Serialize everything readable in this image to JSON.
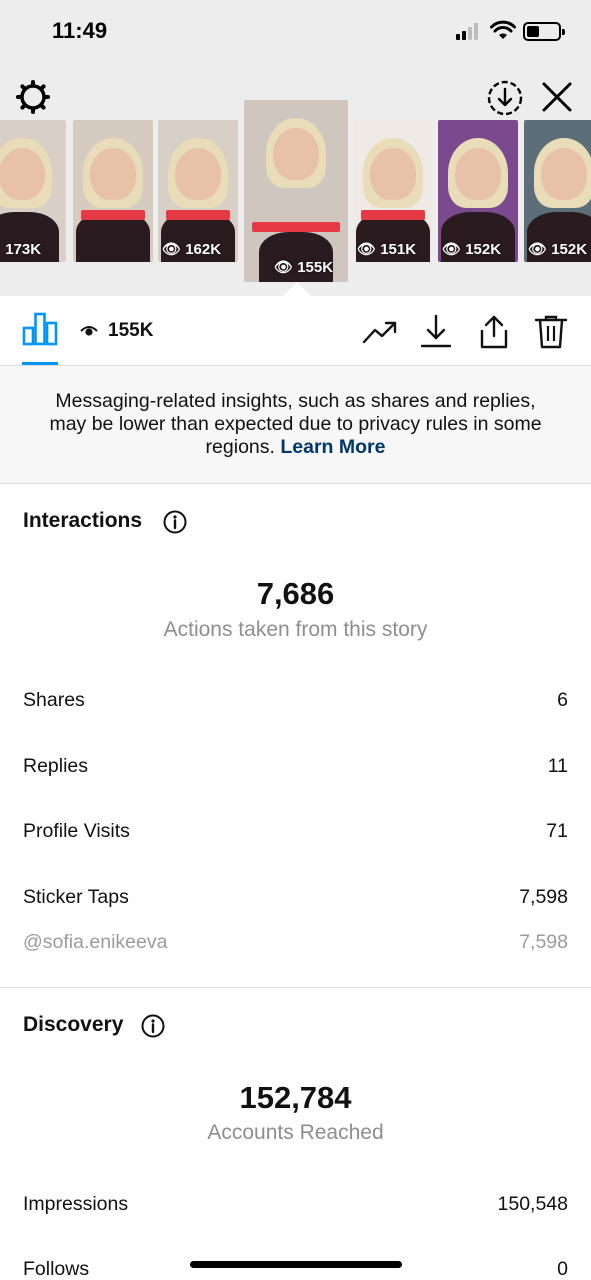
{
  "status_bar": {
    "time": "11:49"
  },
  "stories": [
    {
      "views": "173K",
      "tag": "",
      "bg": "#d9cfc6"
    },
    {
      "views": "",
      "tag": "@sofia.enikeeva",
      "bg": "#d6cbc0"
    },
    {
      "views": "162K",
      "tag": "@sofia.enikeeva",
      "bg": "#d8cfc6"
    },
    {
      "views": "155K",
      "tag": "@sofia.enikeeva",
      "bg": "#cfc7bf",
      "active": true
    },
    {
      "views": "151K",
      "tag": "@sofia.enikeeva",
      "bg": "#efeae6"
    },
    {
      "views": "152K",
      "tag": "",
      "bg": "#7b4a8e"
    },
    {
      "views": "152K",
      "tag": "",
      "bg": "#5c6e78"
    }
  ],
  "toolbar": {
    "views": "155K"
  },
  "banner": {
    "text": "Messaging-related insights, such as shares and replies, may be lower than expected due to privacy rules in some regions.",
    "link": "Learn More"
  },
  "interactions": {
    "title": "Interactions",
    "total": "7,686",
    "total_label": "Actions taken from this story",
    "rows": [
      {
        "label": "Shares",
        "value": "6"
      },
      {
        "label": "Replies",
        "value": "11"
      },
      {
        "label": "Profile Visits",
        "value": "71"
      },
      {
        "label": "Sticker Taps",
        "value": "7,598"
      }
    ],
    "sub_row": {
      "label": "@sofia.enikeeva",
      "value": "7,598"
    }
  },
  "discovery": {
    "title": "Discovery",
    "total": "152,784",
    "total_label": "Accounts Reached",
    "rows": [
      {
        "label": "Impressions",
        "value": "150,548"
      },
      {
        "label": "Follows",
        "value": "0"
      }
    ]
  },
  "colors": {
    "accent": "#0095f6",
    "link": "#00376b",
    "muted": "#8e8e8e"
  }
}
